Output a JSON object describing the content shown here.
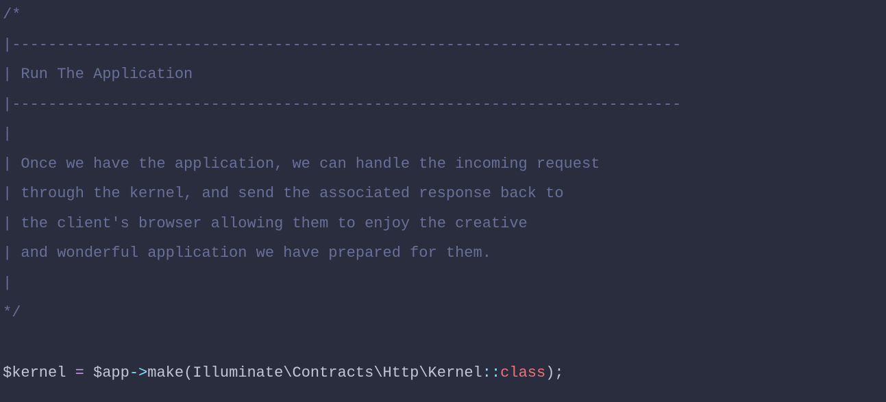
{
  "code": {
    "comment": {
      "open": "/*",
      "line1": "|--------------------------------------------------------------------------",
      "line2": "| Run The Application",
      "line3": "|--------------------------------------------------------------------------",
      "line4": "|",
      "line5": "| Once we have the application, we can handle the incoming request",
      "line6": "| through the kernel, and send the associated response back to",
      "line7": "| the client's browser allowing them to enjoy the creative",
      "line8": "| and wonderful application we have prepared for them.",
      "line9": "|",
      "close": "*/"
    },
    "statement": {
      "var1": "$kernel",
      "equals": " = ",
      "var2": "$app",
      "arrow": "->",
      "method": "make",
      "lparen": "(",
      "ns1": "Illuminate",
      "sep1": "\\",
      "ns2": "Contracts",
      "sep2": "\\",
      "ns3": "Http",
      "sep3": "\\",
      "ns4": "Kernel",
      "scope": "::",
      "keyword": "class",
      "rparen": ")",
      "semi": ";"
    }
  }
}
